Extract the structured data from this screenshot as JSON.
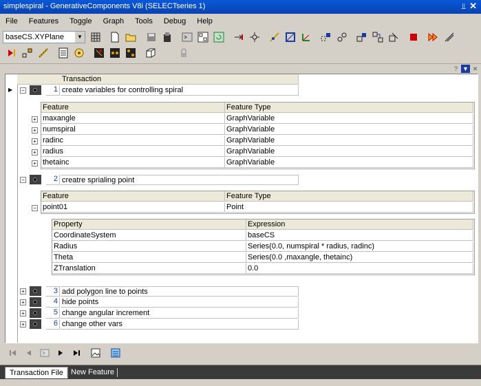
{
  "window": {
    "title": "simplespiral - GenerativeComponents V8i (SELECTseries 1)"
  },
  "menu": [
    "File",
    "Features",
    "Toggle",
    "Graph",
    "Tools",
    "Debug",
    "Help"
  ],
  "toolbar": {
    "plane_combo": "baseCS.XYPlane",
    "row1_icons": [
      "grid-icon",
      "new-file-icon",
      "open-folder-icon",
      "save-icon",
      "save-all-icon",
      "script-icon",
      "layout-icon",
      "refresh-icon",
      "step-into-icon",
      "snap-icon",
      "point-tool-icon",
      "vector-tool-icon",
      "axes-tool-icon",
      "copy-tool-icon",
      "move-tool-icon",
      "arrange-icon",
      "graph-icon",
      "link-icon",
      "stop-icon",
      "play-forward-icon",
      "line-tool-icon"
    ],
    "row2_icons": [
      "record-icon",
      "node-graph-icon",
      "measure-icon",
      "calculator-icon",
      "target-icon",
      "script-icon-2",
      "nodes-icon",
      "nodes-icon-2",
      "box-icon",
      "lock-icon"
    ]
  },
  "panel_controls": [
    "help-icon",
    "dropdown-icon",
    "close-icon"
  ],
  "transactions_header": "Transaction",
  "feature_headers": {
    "feature": "Feature",
    "type": "Feature Type"
  },
  "property_headers": {
    "property": "Property",
    "expression": "Expression"
  },
  "transactions": [
    {
      "num": "1",
      "label": "create variables for controlling spiral",
      "features": [
        {
          "name": "maxangle",
          "type": "GraphVariable"
        },
        {
          "name": "numspiral",
          "type": "GraphVariable"
        },
        {
          "name": "radinc",
          "type": "GraphVariable"
        },
        {
          "name": "radius",
          "type": "GraphVariable"
        },
        {
          "name": "thetainc",
          "type": "GraphVariable"
        }
      ]
    },
    {
      "num": "2",
      "label": "creatre sprialing point",
      "features": [
        {
          "name": "point01",
          "type": "Point"
        }
      ],
      "properties": [
        {
          "name": "CoordinateSystem",
          "expr": "baseCS"
        },
        {
          "name": "Radius",
          "expr": "Series(0.0, numspiral * radius, radinc)"
        },
        {
          "name": "Theta",
          "expr": "Series(0.0 ,maxangle, thetainc)"
        },
        {
          "name": "ZTranslation",
          "expr": "0.0"
        }
      ]
    },
    {
      "num": "3",
      "label": "add polygon line to points"
    },
    {
      "num": "4",
      "label": "hide points"
    },
    {
      "num": "5",
      "label": "change angular increment"
    },
    {
      "num": "6",
      "label": "change other vars"
    }
  ],
  "nav_icons": [
    "first-icon",
    "prev-icon",
    "step-icon",
    "next-icon",
    "last-icon",
    "image-icon",
    "sheet-icon"
  ],
  "tabs": [
    "Transaction File",
    "New Feature"
  ],
  "colors": {
    "title_bar": "#0a58d8",
    "number_text": "#1a3ca0",
    "chrome": "#d4d0c8"
  }
}
